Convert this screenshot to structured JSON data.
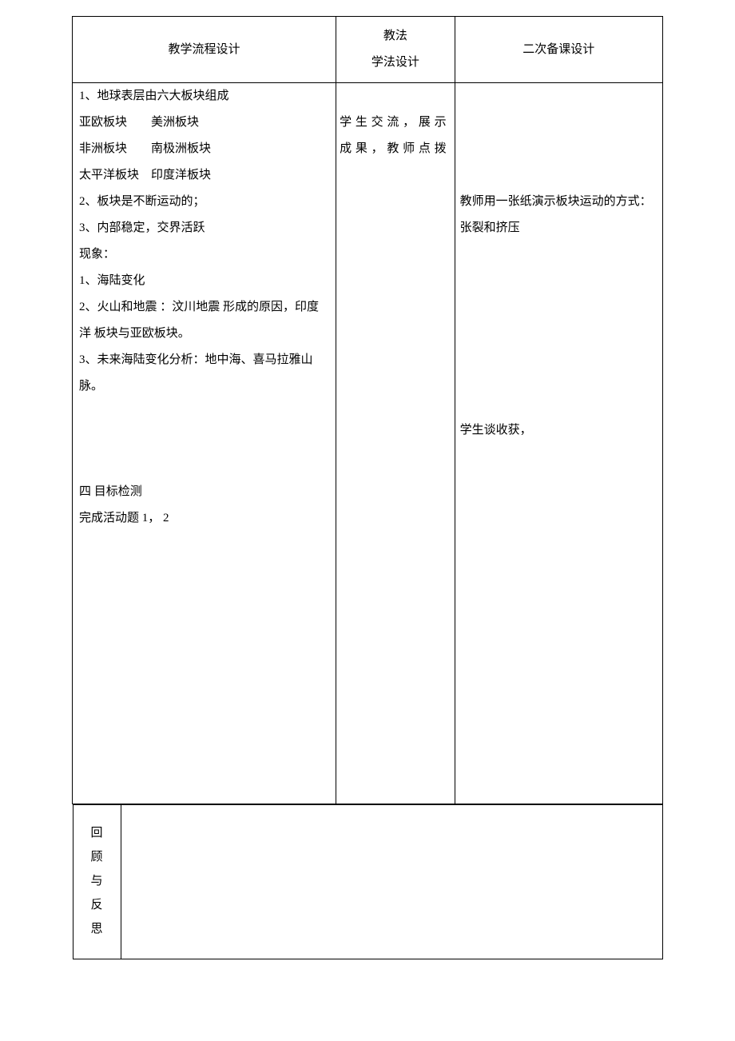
{
  "headers": {
    "col1": "教学流程设计",
    "col2_line1": "教法",
    "col2_line2": "学法设计",
    "col3": "二次备课设计"
  },
  "col1_content": {
    "line1": "1、地球表层由六大板块组成",
    "line2": "亚欧板块　　美洲板块",
    "line3": "非洲板块　　南极洲板块",
    "line4": "太平洋板块　印度洋板块",
    "line5": "2、板块是不断运动的；",
    "line6": "3、内部稳定，交界活跃",
    "line7": "现象：",
    "line8": "1、海陆变化",
    "line9": "2、火山和地震 ：汶川地震 形成的原因，印度洋 板块与亚欧板块。",
    "line10": "3、未来海陆变化分析：地中海、喜马拉雅山脉。",
    "line11": "四 目标检测",
    "line12": "完成活动题 1，  2"
  },
  "col2_content": {
    "text1": "学生交流，展示成果，教师点拨"
  },
  "col3_content": {
    "text1": "教师用一张纸演示板块运动的方式：张裂和挤压",
    "text2": "学生谈收获，"
  },
  "footer": {
    "label_c1": "回",
    "label_c2": "顾",
    "label_c3": "与",
    "label_c4": "反",
    "label_c5": "思"
  }
}
